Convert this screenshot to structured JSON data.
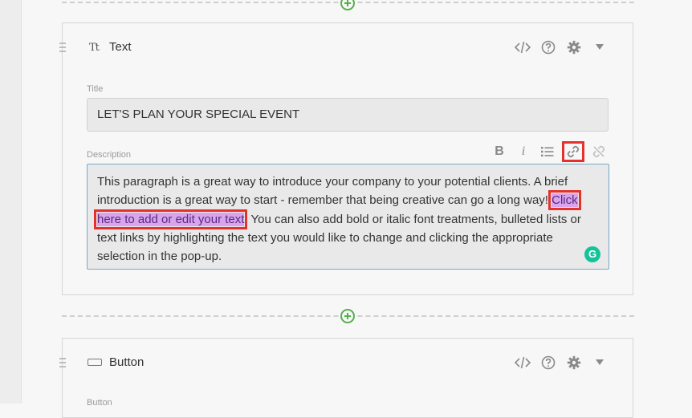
{
  "text_block": {
    "name": "Text",
    "type_icon": "Tt",
    "title_label": "Title",
    "title_value": "LET'S PLAN YOUR SPECIAL EVENT",
    "description_label": "Description",
    "description": {
      "before": "This paragraph is a great way to introduce your company to your potential clients. A brief introduction is a great way to start - remember that being creative can go a long way! ",
      "link": "Click here to add or edit your text",
      "after": ". You can also add bold or italic font treatments, bulleted lists or text links by highlighting the text you would like to change and clicking the appropriate selection in the pop-up."
    },
    "editor_tools": [
      "bold-icon",
      "italic-icon",
      "bullet-list-icon",
      "link-icon",
      "unlink-icon"
    ]
  },
  "button_block": {
    "name": "Button",
    "field_label": "Button"
  },
  "icons": [
    "code-icon",
    "help-icon",
    "gear-icon",
    "caret-down-icon",
    "add-block-icon",
    "grammarly-icon"
  ],
  "colors": {
    "highlight_bg": "#d9a4ea",
    "annotation_red": "#e5302c",
    "add_green": "#55b04a",
    "grammarly_green": "#15c39a"
  }
}
